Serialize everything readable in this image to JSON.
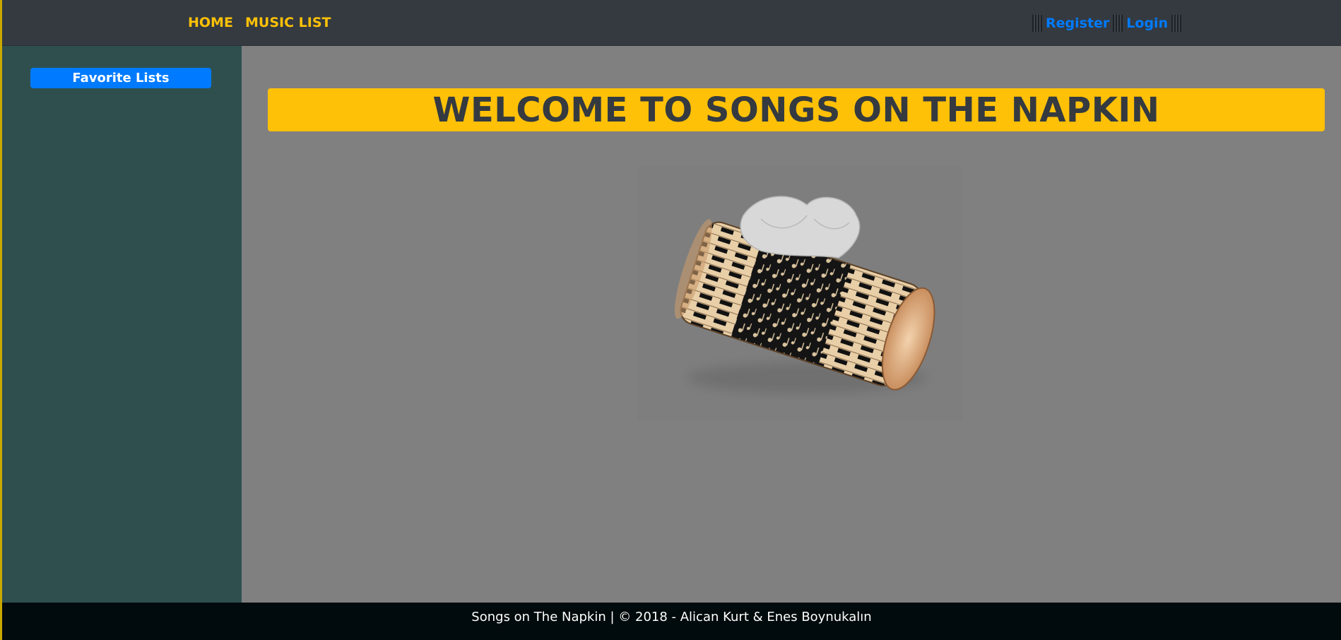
{
  "nav": {
    "home": "HOME",
    "music_list": "MUSIC LIST",
    "register": "Register",
    "login": "Login"
  },
  "sidebar": {
    "favorite_lists": "Favorite Lists"
  },
  "main": {
    "banner_title": "WELCOME TO SONGS ON THE NAPKIN",
    "hero_image": "tissue-box-with-piano-keys-and-music-notes"
  },
  "footer": {
    "text": "Songs on The Napkin | © 2018 - Alican Kurt & Enes Boynukalın"
  },
  "colors": {
    "navbar": "#343a40",
    "accent": "#ffc107",
    "link_blue": "#007bff",
    "sidebar": "#2f4f4f",
    "main_bg": "#808080",
    "footer": "#010a0c"
  }
}
